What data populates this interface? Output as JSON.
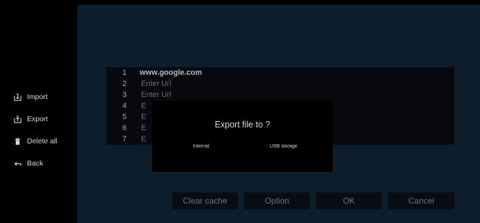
{
  "sidebar": {
    "items": [
      {
        "label": "Import",
        "icon": "import-icon"
      },
      {
        "label": "Export",
        "icon": "export-icon"
      },
      {
        "label": "Delete all",
        "icon": "trash-icon"
      },
      {
        "label": "Back",
        "icon": "back-arrow-icon"
      }
    ]
  },
  "url_list": {
    "rows": [
      {
        "num": "1",
        "value": "www.google.com",
        "filled": true
      },
      {
        "num": "2",
        "value": "Enter Url",
        "filled": false
      },
      {
        "num": "3",
        "value": "Enter Url",
        "filled": false
      },
      {
        "num": "4",
        "value": "E",
        "filled": false
      },
      {
        "num": "5",
        "value": "E",
        "filled": false
      },
      {
        "num": "6",
        "value": "E",
        "filled": false
      },
      {
        "num": "7",
        "value": "E",
        "filled": false
      }
    ]
  },
  "buttons": {
    "clear_cache": "Clear cache",
    "option": "Option",
    "ok": "OK",
    "cancel": "Cancel"
  },
  "dialog": {
    "title": "Export file to ?",
    "options": [
      "Internal",
      "USB storage"
    ]
  },
  "colors": {
    "background": "#000000",
    "main_area": "#0e1d2a",
    "text": "#d8d8d8"
  }
}
